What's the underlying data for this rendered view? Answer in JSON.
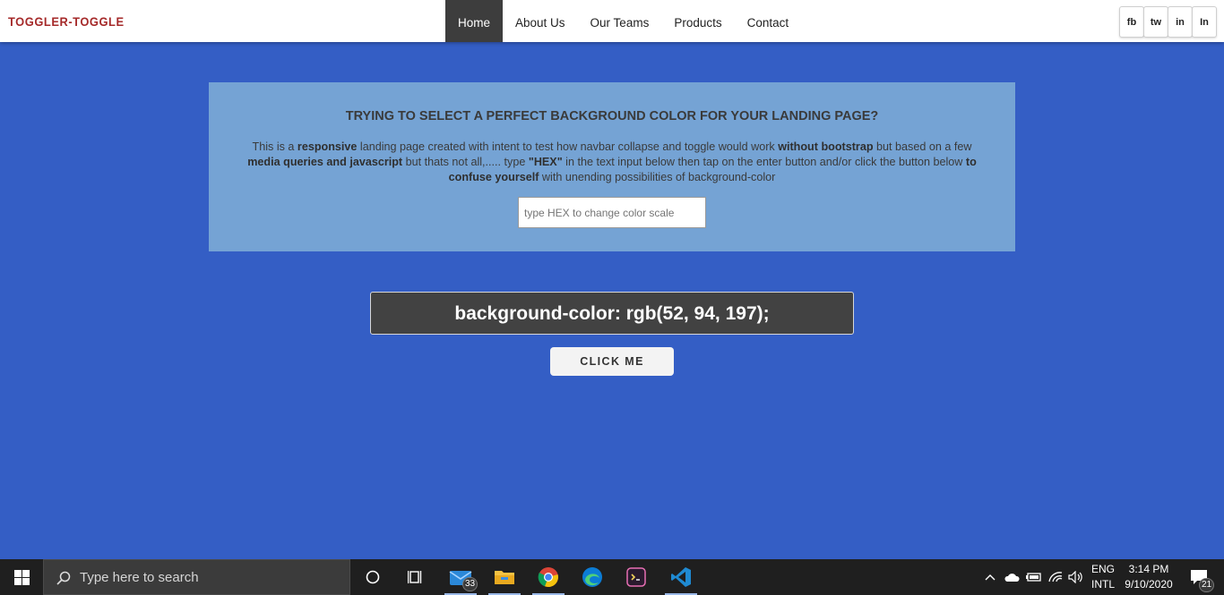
{
  "navbar": {
    "brand": "TOGGLER-TOGGLE",
    "links": [
      "Home",
      "About Us",
      "Our Teams",
      "Products",
      "Contact"
    ],
    "active_link": "Home",
    "social": [
      "fb",
      "tw",
      "in",
      "In"
    ]
  },
  "hero": {
    "title": "TRYING TO SELECT A PERFECT BACKGROUND COLOR FOR YOUR LANDING PAGE?",
    "text": {
      "p1": "This is a ",
      "b1": "responsive",
      "p2": " landing page created with intent to test how navbar collapse and toggle would work ",
      "b2": "without bootstrap",
      "p3": " but based on a few ",
      "b3": "media queries and javascript",
      "p4": " but thats not all,..... type ",
      "b4": "\"HEX\"",
      "p5": " in the text input below then tap on the enter button and/or click the button below ",
      "b5": "to confuse yourself",
      "p6": " with unending possibilities of background-color"
    },
    "input_placeholder": "type HEX to change color scale",
    "input_value": ""
  },
  "color_display": "background-color: rgb(52, 94, 197);",
  "click_button": "CLICK ME",
  "colors": {
    "page_background": "#345ec5",
    "hero_background": "#75a3d4",
    "brand": "#a52a2a",
    "active_nav": "#3d3d3d",
    "display_box": "#424242"
  },
  "taskbar": {
    "search_placeholder": "Type here to search",
    "mail_badge": "33",
    "apps": [
      "cortana-icon",
      "task-view-icon",
      "mail-icon",
      "file-explorer-icon",
      "chrome-icon",
      "edge-icon",
      "terminal-icon",
      "vscode-icon"
    ],
    "tray": {
      "language_line1": "ENG",
      "language_line2": "INTL",
      "time": "3:14 PM",
      "date": "9/10/2020",
      "notifications": "21"
    }
  }
}
